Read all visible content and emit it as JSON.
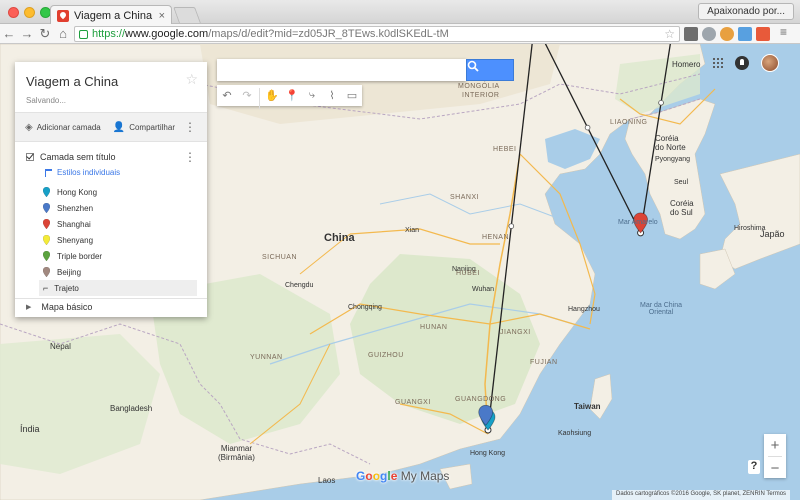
{
  "browser": {
    "tab_title": "Viagem a China",
    "tab_close": "×",
    "profile_button": "Apaixonado por...",
    "url_proto": "https://",
    "url_host": "www.google.com",
    "url_path": "/maps/d/edit?mid=zd05JR_8TEws.k0dlSKEdL-tM"
  },
  "search": {
    "placeholder": "",
    "tools": [
      "undo-icon",
      "redo-icon",
      "hand-icon",
      "marker-icon",
      "line-icon",
      "ruler-icon"
    ]
  },
  "panel": {
    "title": "Viagem a China",
    "status": "Salvando...",
    "add_layer_label": "Adicionar camada",
    "share_label": "Compartilhar",
    "layer_title": "Camada sem título",
    "styles_link": "Estilos individuais",
    "places": [
      {
        "label": "Hong Kong",
        "color": "#17a0c7"
      },
      {
        "label": "Shenzhen",
        "color": "#4a79c8"
      },
      {
        "label": "Shanghai",
        "color": "#db4437"
      },
      {
        "label": "Shenyang",
        "color": "#f4eb37"
      },
      {
        "label": "Triple border",
        "color": "#5ba33f"
      },
      {
        "label": "Beijing",
        "color": "#a1887f"
      }
    ],
    "route_label": "Trajeto",
    "basemap_label": "Mapa básico"
  },
  "map": {
    "labels": {
      "china": "China",
      "mongolia": "MONGÓLIA",
      "mongolia_sub": "INTERIOR",
      "liaoning": "LIAONING",
      "korea_north": "Coréia\ndo Norte",
      "korea_south": "Coréia\ndo Sul",
      "seoul": "Seul",
      "pyongyang": "Pyongyang",
      "japan": "Japão",
      "hiroshima": "Hiroshima",
      "yellow_sea": "Mar Amarelo",
      "east_china_sea": "Mar da China\nOriental",
      "taiwan": "Taiwan",
      "kaohsiung": "Kaohsiung",
      "xian": "Xian",
      "chengdu": "Chengdu",
      "chongqing": "Chongqing",
      "nanjing": "Nanjing",
      "wuhan": "Wuhan",
      "hangzhou": "Hangzhou",
      "guangdong": "GUANGDONG",
      "guizhou": "GUIZHOU",
      "guangxi": "GUANGXI",
      "hubei": "HUBEI",
      "hebei": "HEBEI",
      "shanxi": "SHANXI",
      "henan": "HENAN",
      "sichuan": "SICHUAN",
      "hunan": "HUNAN",
      "jiangxi": "JIANGXI",
      "fujian": "FUJIAN",
      "yunnan": "YUNNAN",
      "nepal": "Nepal",
      "bangladesh": "Bangladesh",
      "myanmar": "Mianmar\n(Birmânia)",
      "laos": "Laos",
      "india": "Índia",
      "hong_kong": "Hong Kong",
      "homero": "Homero"
    },
    "route_points": [
      {
        "name": "Hong Kong",
        "lon": 114.17,
        "lat": 22.32
      },
      {
        "name": "Beijing",
        "lon": 116.4,
        "lat": 39.9
      },
      {
        "name": "Shanghai",
        "lon": 121.47,
        "lat": 31.23
      },
      {
        "name": "Shenyang",
        "lon": 123.43,
        "lat": 41.8
      },
      {
        "name": "Triple border",
        "lon": 130.6,
        "lat": 42.4
      }
    ],
    "logo": "Google My Maps",
    "attribution": "Dados cartográficos ©2016 Google, SK planet, ZENRIN    Termos"
  },
  "controls": {
    "zoom_in": "+",
    "zoom_out": "−",
    "help": "?"
  }
}
